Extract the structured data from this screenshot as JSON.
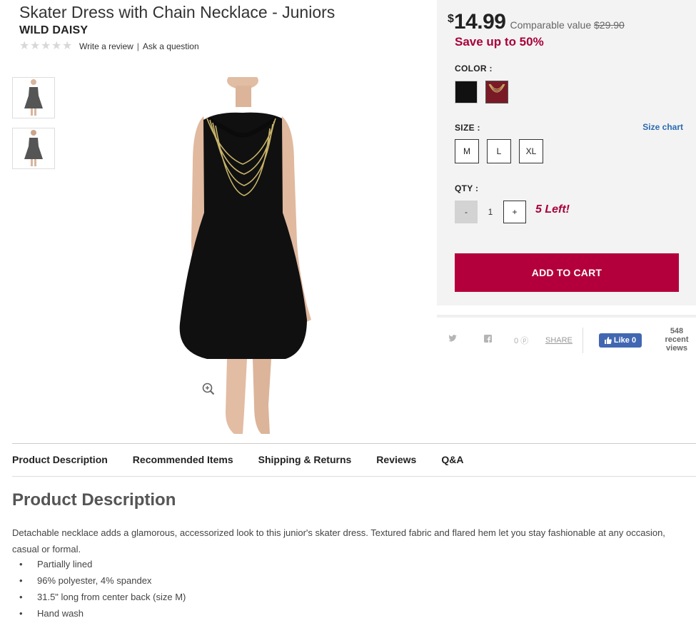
{
  "product": {
    "title": "Skater Dress with Chain Necklace - Juniors",
    "brand": "WILD DAISY",
    "write_review": "Write a review",
    "ask_question": "Ask a question",
    "separator": "|",
    "rating": 0
  },
  "pricing": {
    "currency": "$",
    "price": "14.99",
    "comparable_label": "Comparable value",
    "comparable_price": "$29.90",
    "save_text": "Save up to 50%"
  },
  "options": {
    "color_label": "COLOR :",
    "colors": [
      "#111111",
      "#7a1a26"
    ],
    "size_label": "SIZE :",
    "size_chart": "Size chart",
    "sizes": [
      "M",
      "L",
      "XL"
    ],
    "qty_label": "QTY :",
    "qty_minus": "-",
    "qty_value": "1",
    "qty_plus": "+",
    "stock_note": "5  Left!",
    "add_to_cart": "ADD TO CART"
  },
  "social": {
    "pin_count": "0",
    "share": "SHARE",
    "like": "Like 0",
    "views_count": "548",
    "views_label1": "recent",
    "views_label2": "views"
  },
  "tabs": [
    "Product Description",
    "Recommended Items",
    "Shipping & Returns",
    "Reviews",
    "Q&A"
  ],
  "description": {
    "heading": "Product Description",
    "text": "Detachable necklace adds a glamorous, accessorized look to this junior's skater dress. Textured fabric and flared hem let you stay fashionable at any occasion, casual or formal.",
    "bullets": [
      "Partially lined",
      "96% polyester, 4% spandex",
      "31.5\" long from center back (size M)",
      "Hand wash"
    ]
  },
  "colors": {
    "accent": "#b3003c",
    "save": "#a8003b",
    "link": "#2a6bb0",
    "panel_bg": "#f3f3f3"
  }
}
